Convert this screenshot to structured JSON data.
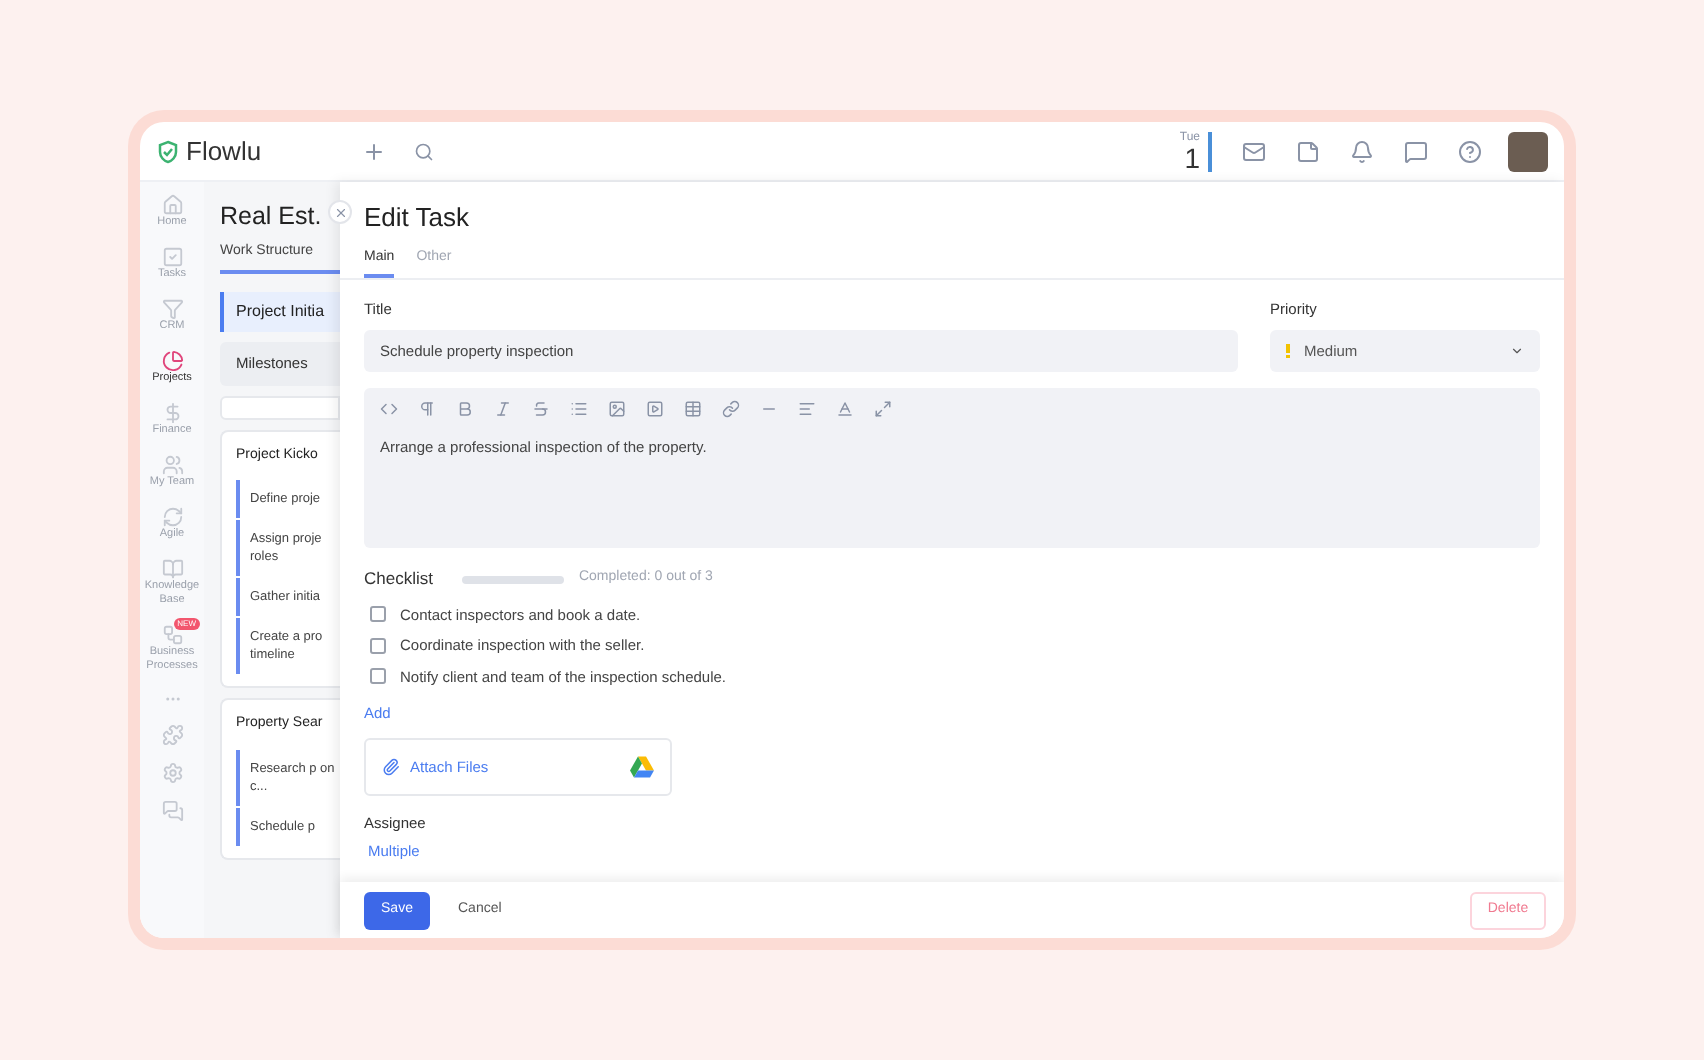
{
  "header": {
    "brand": "Flowlu",
    "date": {
      "weekday": "Tue",
      "day": "1"
    }
  },
  "sidebar": {
    "items": [
      {
        "kind": "home",
        "label": "Home",
        "selected": false
      },
      {
        "kind": "tasks",
        "label": "Tasks",
        "selected": false
      },
      {
        "kind": "crm",
        "label": "CRM",
        "selected": false
      },
      {
        "kind": "projects",
        "label": "Projects",
        "selected": true
      },
      {
        "kind": "finance",
        "label": "Finance",
        "selected": false
      },
      {
        "kind": "team",
        "label": "My Team",
        "selected": false
      },
      {
        "kind": "agile",
        "label": "Agile",
        "selected": false
      },
      {
        "kind": "knowledge",
        "label": "Knowledge Base",
        "selected": false
      },
      {
        "kind": "processes",
        "label": "Business Processes",
        "selected": false,
        "badge": "NEW"
      }
    ]
  },
  "project": {
    "title": "Real Est.",
    "tab": "Work Structure",
    "stage": "Project Initia",
    "milestones": "Milestones",
    "groups": [
      {
        "title": "Project Kicko",
        "tasks": [
          "Define proje",
          "Assign proje roles",
          "Gather initia",
          "Create a pro timeline"
        ]
      },
      {
        "title": "Property Sear",
        "tasks": [
          "Research p on c...",
          "Schedule p"
        ]
      }
    ]
  },
  "drawer": {
    "title": "Edit Task",
    "tabs": [
      {
        "label": "Main",
        "selected": true
      },
      {
        "label": "Other",
        "selected": false
      }
    ],
    "title_field": {
      "label": "Title",
      "value": "Schedule property inspection"
    },
    "priority": {
      "label": "Priority",
      "value": "Medium"
    },
    "description": "Arrange a professional inspection of the property.",
    "checklist": {
      "label": "Checklist",
      "level": 0,
      "progress_text": "Completed: 0 out of 3",
      "items": [
        {
          "label": "Contact inspectors and book a date.",
          "checked": false
        },
        {
          "label": "Coordinate inspection with the seller.",
          "checked": false
        },
        {
          "label": "Notify client and team of the inspection schedule.",
          "checked": false
        }
      ],
      "add": "Add"
    },
    "attach": "Attach Files",
    "assignee": {
      "label": "Assignee",
      "value": "Multiple"
    },
    "footer": {
      "save": "Save",
      "cancel": "Cancel",
      "delete": "Delete"
    }
  }
}
